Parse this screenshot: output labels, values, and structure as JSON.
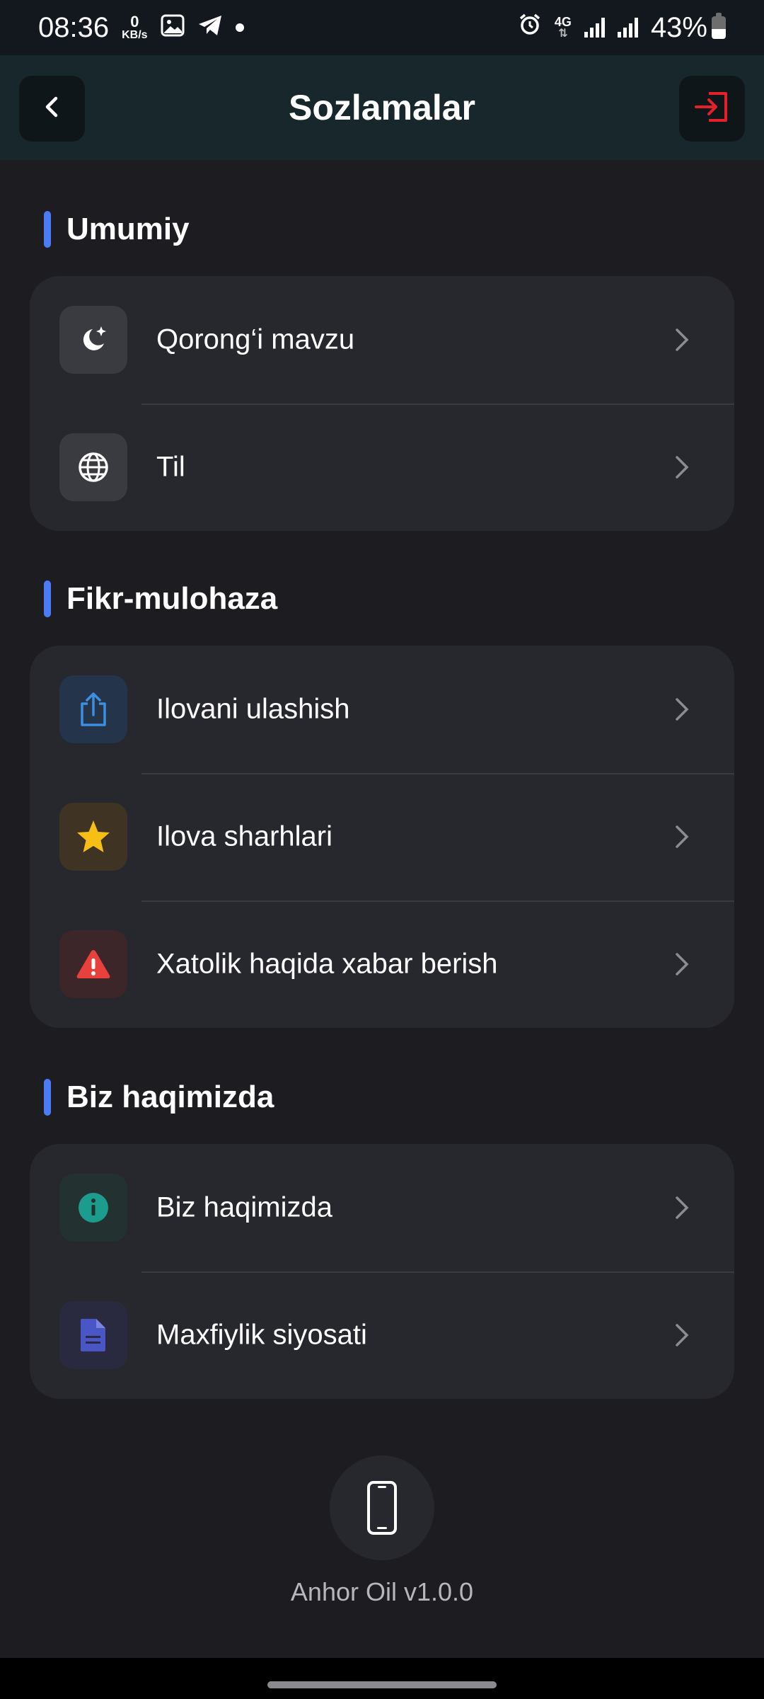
{
  "status_bar": {
    "time": "08:36",
    "net_speed": "0",
    "net_unit": "KB/s",
    "network": "4G",
    "battery": "43%",
    "battery_level": 0.43
  },
  "header": {
    "title": "Sozlamalar",
    "back_icon": "chevron-left-icon",
    "logout_icon": "logout-icon",
    "logout_color": "#e5202a"
  },
  "sections": [
    {
      "title": "Umumiy",
      "items": [
        {
          "label": "Qorong‘i mavzu",
          "icon": "moon-stars-icon",
          "icon_bg": "#3a3a41"
        },
        {
          "label": "Til",
          "icon": "globe-icon",
          "icon_bg": "#3a3a41"
        }
      ]
    },
    {
      "title": "Fikr-mulohaza",
      "items": [
        {
          "label": "Ilovani ulashish",
          "icon": "share-icon",
          "icon_bg": "#24344a",
          "icon_color": "#3e8fe0"
        },
        {
          "label": "Ilova sharhlari",
          "icon": "star-icon",
          "icon_bg": "#3f3424",
          "icon_color": "#f7be16"
        },
        {
          "label": "Xatolik haqida xabar berish",
          "icon": "warning-icon",
          "icon_bg": "#3d2629",
          "icon_color": "#e8403d"
        }
      ]
    },
    {
      "title": "Biz haqimizda",
      "items": [
        {
          "label": "Biz haqimizda",
          "icon": "info-icon",
          "icon_bg": "#233131",
          "icon_color": "#1b9c8c"
        },
        {
          "label": "Maxfiylik siyosati",
          "icon": "document-icon",
          "icon_bg": "#292a40",
          "icon_color": "#4a56c6"
        }
      ]
    }
  ],
  "footer": {
    "icon": "smartphone-icon",
    "version": "Anhor Oil v1.0.0"
  },
  "colors": {
    "accent": "#4b7bf5",
    "background": "#1c1c21",
    "card": "#27272e"
  }
}
